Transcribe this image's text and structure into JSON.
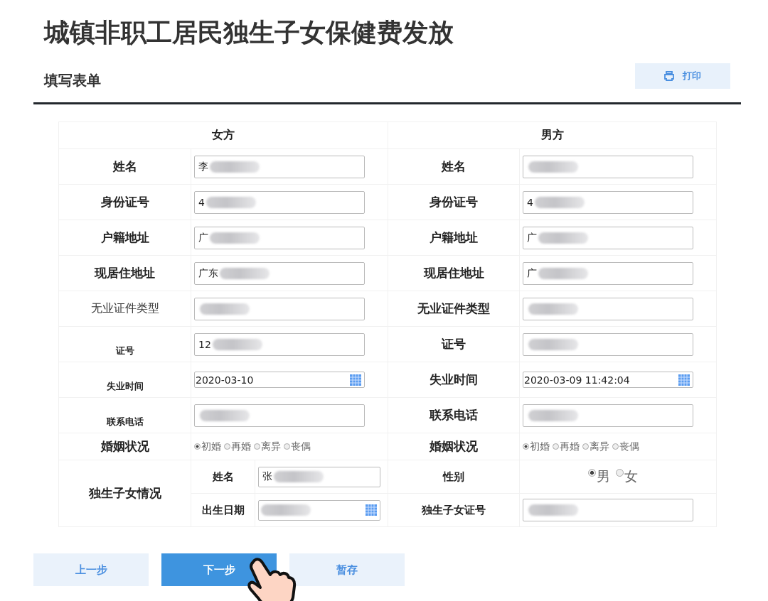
{
  "title": "城镇非职工居民独生子女保健费发放",
  "section": {
    "title": "填写表单",
    "print_button": "打印"
  },
  "form": {
    "columns": [
      "女方",
      "男方"
    ],
    "rows": [
      {
        "left": {
          "label": "姓名",
          "label_bold": true,
          "label_small": false,
          "kind": "text",
          "value": "李",
          "blurred": true
        },
        "right": {
          "label": "姓名",
          "label_bold": true,
          "label_small": false,
          "kind": "text",
          "blurred": true
        }
      },
      {
        "left": {
          "label": "身份证号",
          "label_bold": true,
          "label_small": false,
          "kind": "text",
          "value": "4",
          "blurred": true
        },
        "right": {
          "label": "身份证号",
          "label_bold": true,
          "label_small": false,
          "kind": "text",
          "value": "4",
          "blurred": true
        }
      },
      {
        "left": {
          "label": "户籍地址",
          "label_bold": true,
          "label_small": false,
          "kind": "text",
          "value": "广",
          "blurred": true
        },
        "right": {
          "label": "户籍地址",
          "label_bold": true,
          "label_small": false,
          "kind": "text",
          "value": "广",
          "blurred": true
        }
      },
      {
        "left": {
          "label": "现居住地址",
          "label_bold": true,
          "label_small": false,
          "kind": "text",
          "value": "广东",
          "blurred": true
        },
        "right": {
          "label": "现居住地址",
          "label_bold": true,
          "label_small": false,
          "kind": "text",
          "value": "广",
          "blurred": true
        }
      },
      {
        "left": {
          "label": "无业证件类型",
          "label_bold": false,
          "label_small": false,
          "kind": "text",
          "blurred": true
        },
        "right": {
          "label": "无业证件类型",
          "label_bold": true,
          "label_small": false,
          "kind": "text",
          "blurred": true
        }
      },
      {
        "left": {
          "label": "证号",
          "label_bold": true,
          "label_small": true,
          "kind": "text",
          "value": "12",
          "blurred": true
        },
        "right": {
          "label": "证号",
          "label_bold": true,
          "label_small": false,
          "kind": "text",
          "blurred": true
        }
      },
      {
        "left": {
          "label": "失业时间",
          "label_bold": true,
          "label_small": true,
          "kind": "date",
          "value": "2020-03-10"
        },
        "right": {
          "label": "失业时间",
          "label_bold": true,
          "label_small": false,
          "kind": "date",
          "value": "2020-03-09 11:42:04"
        }
      },
      {
        "left": {
          "label": "联系电话",
          "label_bold": true,
          "label_small": true,
          "kind": "text",
          "blurred": true
        },
        "right": {
          "label": "联系电话",
          "label_bold": true,
          "label_small": false,
          "kind": "text",
          "blurred": true
        }
      },
      {
        "left": {
          "label": "婚姻状况",
          "label_bold": true,
          "label_small": false,
          "kind": "radio",
          "options": [
            {
              "label": "初婚",
              "selected": true
            },
            {
              "label": "再婚",
              "selected": false
            },
            {
              "label": "离异",
              "selected": false
            },
            {
              "label": "丧偶",
              "selected": false
            }
          ]
        },
        "right": {
          "label": "婚姻状况",
          "label_bold": true,
          "label_small": false,
          "kind": "radio",
          "options": [
            {
              "label": "初婚",
              "selected": true
            },
            {
              "label": "再婚",
              "selected": false
            },
            {
              "label": "离异",
              "selected": false
            },
            {
              "label": "丧偶",
              "selected": false
            }
          ]
        }
      }
    ],
    "child": {
      "label": "独生子女情况",
      "left": [
        {
          "label": "姓名",
          "kind": "text",
          "value": "张",
          "blurred": true
        },
        {
          "label": "出生日期",
          "kind": "date",
          "blurred": true
        }
      ],
      "right": [
        {
          "label": "性别",
          "kind": "radio",
          "options": [
            {
              "label": "男",
              "selected": true
            },
            {
              "label": "女",
              "selected": false
            }
          ]
        },
        {
          "label": "独生子女证号",
          "kind": "text",
          "blurred": true
        }
      ]
    }
  },
  "buttons": [
    {
      "label": "上一步",
      "primary": false
    },
    {
      "label": "下一步",
      "primary": true
    },
    {
      "label": "暂存",
      "primary": false
    }
  ]
}
